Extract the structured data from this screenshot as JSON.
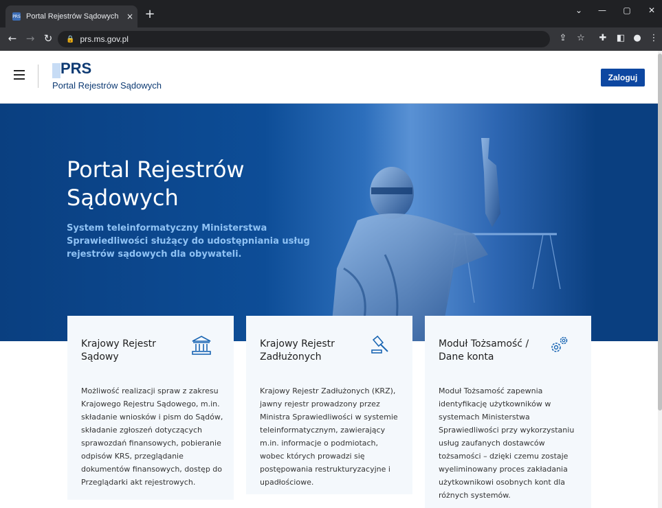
{
  "browser": {
    "tab_title": "Portal Rejestrów Sądowych",
    "tab_favicon": "PRS",
    "tab_close": "×",
    "new_tab": "+",
    "url": "prs.ms.gov.pl",
    "chevron": "⌄",
    "minimize": "—",
    "maximize": "▢",
    "close": "✕"
  },
  "header": {
    "logo": "PRS",
    "logo_subtitle": "Portal Rejestrów Sądowych",
    "login_label": "Zaloguj"
  },
  "hero": {
    "title_line1": "Portal Rejestrów",
    "title_line2": "Sądowych",
    "subtitle": "System teleinformatyczny Ministerstwa Sprawiedliwości służący do udostępniania usług rejestrów sądowych dla obywateli."
  },
  "cards": [
    {
      "title": "Krajowy Rejestr Sądowy",
      "icon": "courthouse-icon",
      "text": "Możliwość realizacji spraw z zakresu Krajowego Rejestru Sądowego, m.in. składanie wniosków i pism do Sądów, składanie zgłoszeń dotyczących sprawozdań finansowych, pobieranie odpisów KRS, przeglądanie dokumentów finansowych, dostęp do Przeglądarki akt rejestrowych."
    },
    {
      "title": "Krajowy Rejestr Zadłużonych",
      "icon": "gavel-icon",
      "text": "Krajowy Rejestr Zadłużonych (KRZ), jawny rejestr prowadzony przez Ministra Sprawiedliwości w systemie teleinformatycznym, zawierający m.in. informacje o podmiotach, wobec których prowadzi się postępowania restrukturyzacyjne i upadłościowe."
    },
    {
      "title": "Moduł Tożsamość / Dane konta",
      "icon": "gears-icon",
      "text": "Moduł Tożsamość zapewnia identyfikację użytkowników w systemach Ministerstwa Sprawiedliwości przy wykorzystaniu usług zaufanych dostawców tożsamości – dzięki czemu zostaje wyeliminowany proces zakładania użytkownikowi osobnych kont dla różnych systemów."
    }
  ],
  "colors": {
    "brand_blue": "#0d47a1",
    "hero_dark": "#0a3f80",
    "card_bg": "#f4f8fc"
  }
}
